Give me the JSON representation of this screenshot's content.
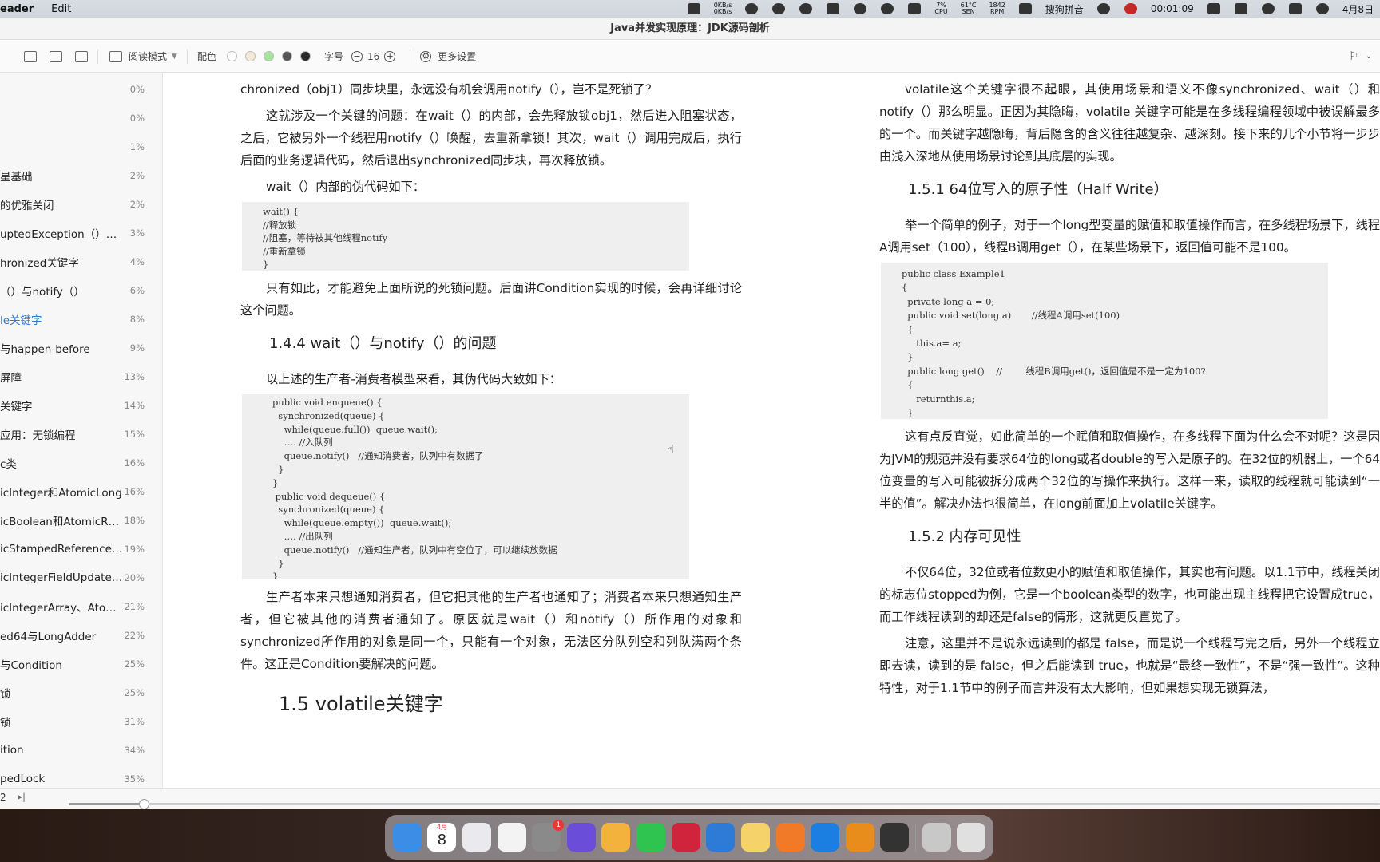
{
  "menubar": {
    "app": "eader",
    "edit": "Edit",
    "net_up": "0KB/s",
    "net_down": "0KB/s",
    "cpu_pct": "7%",
    "cpu_label": "CPU",
    "temp": "61°C",
    "temp_label": "SEN",
    "rpm": "1842",
    "rpm_label": "RPM",
    "ime": "搜狗拼音",
    "timer": "00:01:09",
    "date": "4月8日"
  },
  "window": {
    "title": "Java并发实现原理：JDK源码剖析"
  },
  "toolbar": {
    "read_mode": "阅读模式",
    "color_label": "配色",
    "font_label": "字号",
    "font_size": "16",
    "more_settings": "更多设置",
    "swatches": [
      "#ffffff",
      "#f6e8d8",
      "#a6e39b",
      "#555555",
      "#2b2b2b"
    ]
  },
  "toc": [
    {
      "label": "",
      "pct": "0%"
    },
    {
      "label": "",
      "pct": "0%"
    },
    {
      "label": "",
      "pct": "1%"
    },
    {
      "label": "星基础",
      "pct": "2%"
    },
    {
      "label": "的优雅关闭",
      "pct": "2%"
    },
    {
      "label": "uptedException（）…",
      "pct": "3%"
    },
    {
      "label": "hronized关键字",
      "pct": "4%"
    },
    {
      "label": "（）与notify（）",
      "pct": "6%"
    },
    {
      "label": "le关键字",
      "pct": "8%",
      "active": true
    },
    {
      "label": "与happen-before",
      "pct": "9%"
    },
    {
      "label": "屏障",
      "pct": "13%"
    },
    {
      "label": "关键字",
      "pct": "14%"
    },
    {
      "label": "应用：无锁编程",
      "pct": "15%"
    },
    {
      "label": "c类",
      "pct": "16%"
    },
    {
      "label": "icInteger和AtomicLong",
      "pct": "16%"
    },
    {
      "label": "icBoolean和AtomicR…",
      "pct": "18%"
    },
    {
      "label": "icStampedReference…",
      "pct": "19%"
    },
    {
      "label": "icIntegerFieldUpdate…",
      "pct": "20%"
    },
    {
      "label": "icIntegerArray、Ato…",
      "pct": "21%"
    },
    {
      "label": "ed64与LongAdder",
      "pct": "22%"
    },
    {
      "label": "与Condition",
      "pct": "25%"
    },
    {
      "label": "锁",
      "pct": "25%"
    },
    {
      "label": "锁",
      "pct": "31%"
    },
    {
      "label": "ition",
      "pct": "34%"
    },
    {
      "label": "pedLock",
      "pct": "35%"
    }
  ],
  "left_page": {
    "p1": "chronized（obj1）同步块里，永远没有机会调用notify（），岂不是死锁了？",
    "p2": "这就涉及一个关键的问题：在wait（）的内部，会先释放锁obj1，然后进入阻塞状态，之后，它被另外一个线程用notify（）唤醒，去重新拿锁！其次，wait（）调用完成后，执行后面的业务逻辑代码，然后退出synchronized同步块，再次释放锁。",
    "p3": "wait（）内部的伪代码如下：",
    "code1": "wait() {\n//释放锁\n//阻塞，等待被其他线程notify\n//重新拿锁\n}",
    "p4": "只有如此，才能避免上面所说的死锁问题。后面讲Condition实现的时候，会再详细讨论这个问题。",
    "h1": "1.4.4 wait（）与notify（）的问题",
    "p5": "以上述的生产者-消费者模型来看，其伪代码大致如下：",
    "code2": "public void enqueue() {\n  synchronized(queue) {\n    while(queue.full())  queue.wait();\n    …. //入队列\n    queue.notify()   //通知消费者，队列中有数据了\n  }\n}\n public void dequeue() {\n  synchronized(queue) {\n    while(queue.empty())  queue.wait();\n    …. //出队列\n    queue.notify()   //通知生产者，队列中有空位了，可以继续放数据\n  }\n}",
    "p6": "生产者本来只想通知消费者，但它把其他的生产者也通知了；消费者本来只想通知生产者，但它被其他的消费者通知了。原因就是wait（）和notify（）所作用的对象和synchronized所作用的对象是同一个，只能有一个对象，无法区分队列空和列队满两个条件。这正是Condition要解决的问题。",
    "h2": "1.5 volatile关键字"
  },
  "right_page": {
    "p1": "volatile这个关键字很不起眼，其使用场景和语义不像synchronized、wait（）和notify（）那么明显。正因为其隐晦，volatile 关键字可能是在多线程编程领域中被误解最多的一个。而关键字越隐晦，背后隐含的含义往往越复杂、越深刻。接下来的几个小节将一步步由浅入深地从使用场景讨论到其底层的实现。",
    "h1": "1.5.1 64位写入的原子性（Half Write）",
    "p2": "举一个简单的例子，对于一个long型变量的赋值和取值操作而言，在多线程场景下，线程A调用set（100），线程B调用get（），在某些场景下，返回值可能不是100。",
    "code1": "public class Example1\n{\n  private long a = 0;\n  public void set(long a)       //线程A调用set(100)\n  {\n     this.a= a;\n  }\n  public long get()    //        线程B调用get()，返回值是不是一定为100?\n  {\n     returnthis.a;\n  }\n}",
    "p3": "这有点反直觉，如此简单的一个赋值和取值操作，在多线程下面为什么会不对呢？这是因为JVM的规范并没有要求64位的long或者double的写入是原子的。在32位的机器上，一个64位变量的写入可能被拆分成两个32位的写操作来执行。这样一来，读取的线程就可能读到“一半的值”。解决办法也很简单，在long前面加上volatile关键字。",
    "h2": "1.5.2 内存可见性",
    "p4": "不仅64位，32位或者位数更小的赋值和取值操作，其实也有问题。以1.1节中，线程关闭的标志位stopped为例，它是一个boolean类型的数字，也可能出现主线程把它设置成true，而工作线程读到的却还是false的情形，这就更反直觉了。",
    "p5": "注意，这里并不是说永远读到的都是 false，而是说一个线程写完之后，另外一个线程立即去读，读到的是 false，但之后能读到 true，也就是“最终一致性”，不是“强一致性”。这种特性，对于1.1节中的例子而言并没有太大影响，但如果想实现无锁算法，"
  },
  "bottombar": {
    "page_num": "2",
    "progress": 0.057
  },
  "dock": {
    "calendar_month": "4月",
    "calendar_day": "8",
    "badge": "1",
    "colors": [
      "#3b8de6",
      "#ffffff",
      "#e9e9ee",
      "#f3f3f3",
      "#8a8a8a",
      "#6a4dd8",
      "#f2b23c",
      "#2fc34f",
      "#d0243c",
      "#2d7bd6",
      "#f6d36a",
      "#f07a28",
      "#1a7fe0",
      "#e88c1c",
      "#333333",
      "#e8eef8",
      "#c8c8c8",
      "#e0e0e0"
    ]
  }
}
